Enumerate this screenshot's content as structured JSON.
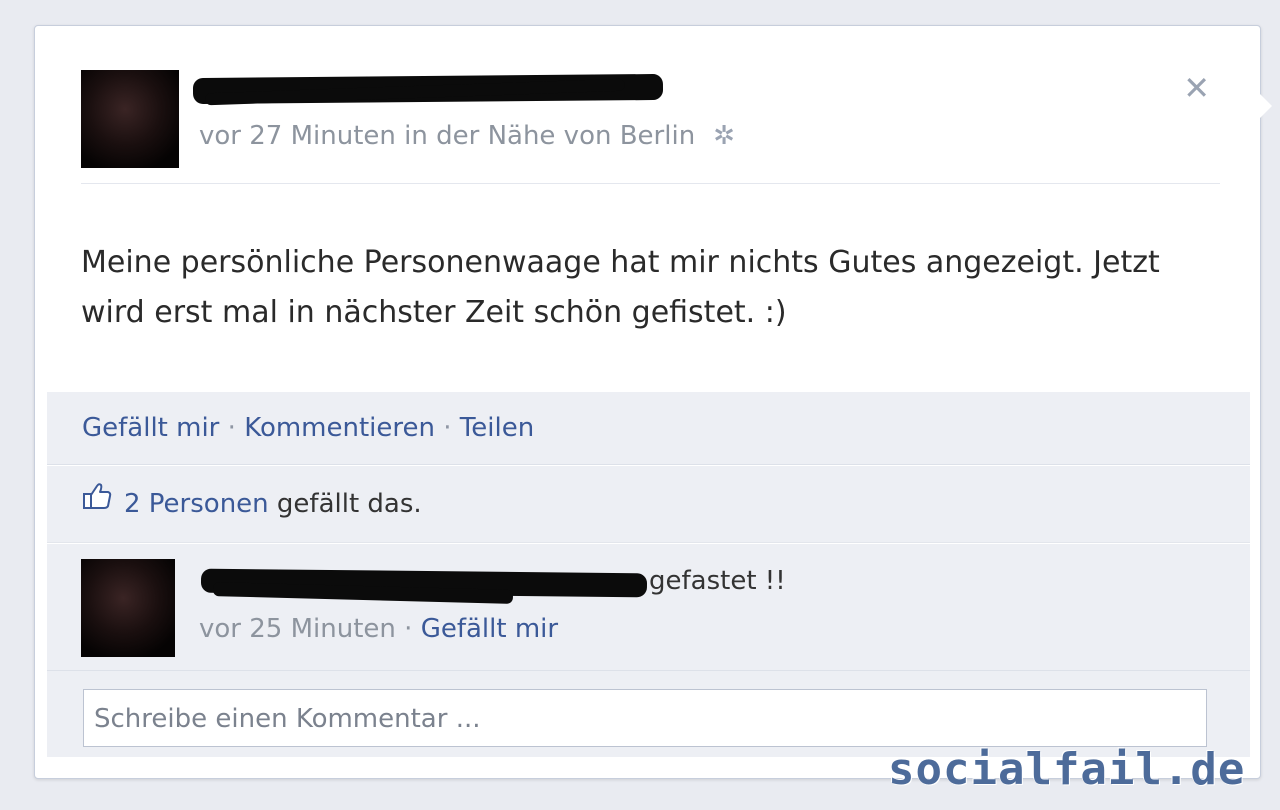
{
  "post": {
    "meta": "vor 27 Minuten in der Nähe von Berlin",
    "text": "Meine persönliche Personenwaage hat mir nichts Gutes angezeigt. Jetzt wird erst mal in nächster Zeit schön gefistet. :)",
    "close_icon": "close-icon",
    "gear_icon": "gear-icon"
  },
  "actions": {
    "like": "Gefällt mir",
    "comment": "Kommentieren",
    "share": "Teilen",
    "separator": "·"
  },
  "likes": {
    "link": "2 Personen",
    "rest": "gefällt das."
  },
  "comment": {
    "text": "gefastet !!",
    "time": "vor 25 Minuten",
    "like": "Gefällt mir"
  },
  "input": {
    "placeholder": "Schreibe einen Kommentar ..."
  },
  "watermark": "socialfail.de",
  "colors": {
    "link": "#3b5998",
    "meta": "#8d949e",
    "panel": "#edeff4"
  }
}
